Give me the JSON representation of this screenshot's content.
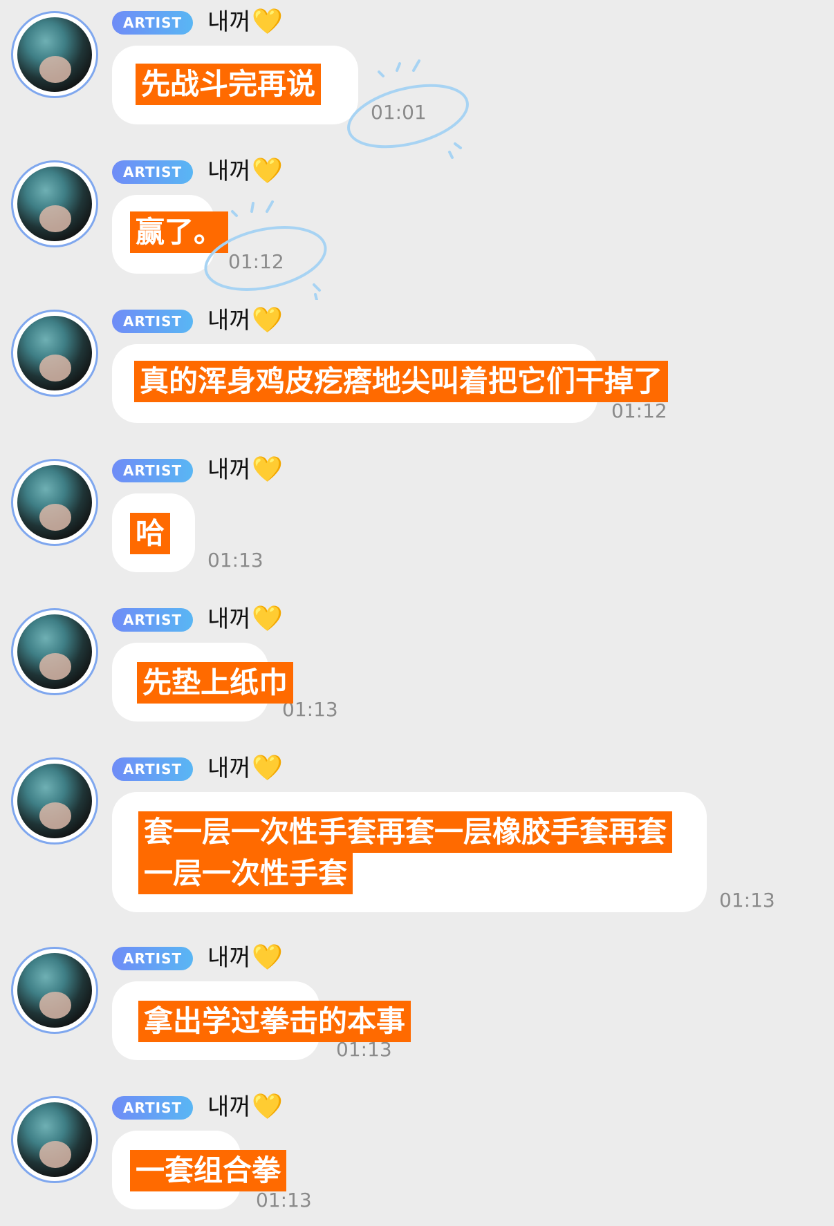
{
  "badge_label": "ARTIST",
  "sender_name": "내꺼",
  "heart_glyph": "💛",
  "highlight_color": "#ff6a00",
  "badge_color": "#6f8cf6",
  "avatar_icon": "profile-photo",
  "messages": [
    {
      "text": "先战斗完再说",
      "time": "01:01"
    },
    {
      "text": "赢了。",
      "time": "01:12"
    },
    {
      "text": "真的浑身鸡皮疙瘩地尖叫着把它们干掉了",
      "time": "01:12"
    },
    {
      "text": "哈",
      "time": "01:13"
    },
    {
      "text": "先垫上纸巾",
      "time": "01:13"
    },
    {
      "text_line1": "套一层一次性手套再套一层橡胶手套再套",
      "text_line2": "一层一次性手套",
      "time": "01:13"
    },
    {
      "text": "拿出学过拳击的本事",
      "time": "01:13"
    },
    {
      "text": "一套组合拳",
      "time": "01:13"
    }
  ]
}
